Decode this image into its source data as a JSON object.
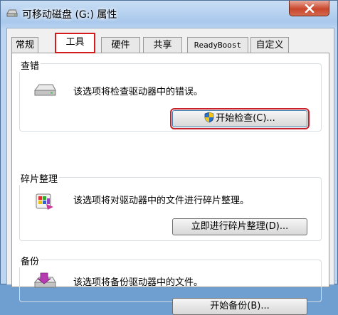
{
  "window": {
    "title": "可移动磁盘 (G:) 属性",
    "icons": {
      "title": "removable-drive-icon",
      "close": "close-icon"
    }
  },
  "tabs": [
    {
      "label": "常规",
      "active": false
    },
    {
      "label": "工具",
      "active": true
    },
    {
      "label": "硬件",
      "active": false
    },
    {
      "label": "共享",
      "active": false
    },
    {
      "label": "ReadyBoost",
      "active": false
    },
    {
      "label": "自定义",
      "active": false
    }
  ],
  "groups": {
    "error_check": {
      "title": "查错",
      "description": "该选项将检查驱动器中的错误。",
      "button": "开始检查(C)...",
      "icon": "drive-check-icon"
    },
    "defrag": {
      "title": "碎片整理",
      "description": "该选项将对驱动器中的文件进行碎片整理。",
      "button": "立即进行碎片整理(D)...",
      "icon": "defrag-icon"
    },
    "backup": {
      "title": "备份",
      "description": "该选项将备份驱动器中的文件。",
      "button": "开始备份(B)...",
      "icon": "backup-icon"
    }
  },
  "colors": {
    "highlight": "#d41a1a",
    "title_bar": "#a9c8ec"
  }
}
